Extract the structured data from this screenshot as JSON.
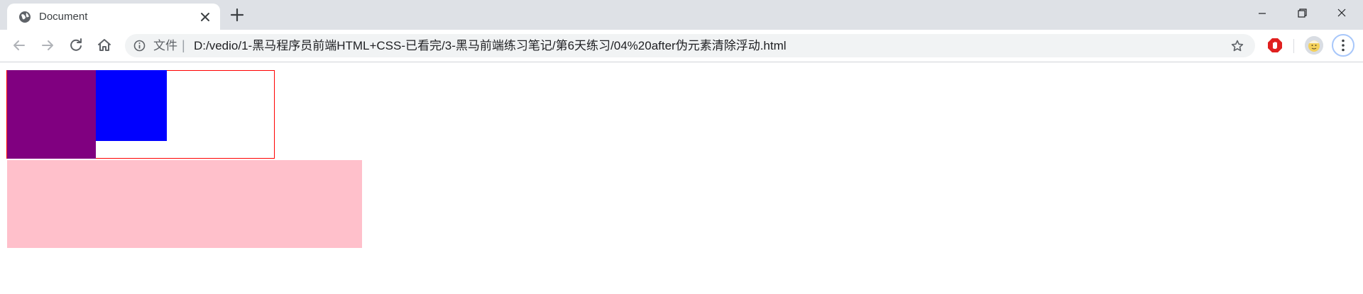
{
  "tab": {
    "title": "Document",
    "favicon_icon": "globe-icon",
    "close_icon": "close-icon"
  },
  "new_tab_icon": "plus-icon",
  "window_controls": [
    "minimize-icon",
    "restore-icon",
    "close-icon"
  ],
  "toolbar": {
    "back_icon": "arrow-left-icon",
    "forward_icon": "arrow-right-icon",
    "reload_icon": "reload-icon",
    "home_icon": "home-icon"
  },
  "omnibox": {
    "scheme_label": "文件",
    "separator": "|",
    "url": "D:/vedio/1-黑马程序员前端HTML+CSS-已看完/3-黑马前端练习笔记/第6天练习/04%20after伪元素清除浮动.html",
    "bookmark_icon": "star-icon"
  },
  "extensions": [
    "adblock-icon"
  ],
  "colors": {
    "box_border": "#ff0000",
    "purple": "#800080",
    "blue": "#0000ff",
    "pink": "#ffc0cb",
    "tabstrip": "#dee1e6"
  }
}
